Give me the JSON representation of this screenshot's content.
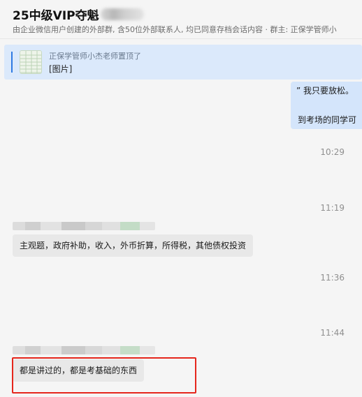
{
  "header": {
    "title": "25中级VIP夺魁",
    "subtitle": "由企业微信用户创建的外部群, 含50位外部联系人, 均已同意存档会话内容 · 群主: 正保学管师小"
  },
  "pinned": {
    "meta": "正保学管师小杰老师置顶了",
    "content": "[图片]"
  },
  "messages": {
    "right_bubble": {
      "line1": "” 我只要放松。",
      "line2": "到考场的同学可"
    },
    "time1": "10:29",
    "time2": "11:19",
    "msg1": "主观题，政府补助，收入，外币折算，所得税，其他债权投资",
    "time3": "11:36",
    "time4": "11:44",
    "msg2": "都是讲过的，都是考基础的东西"
  },
  "colors": {
    "accent": "#2f7be3",
    "highlight": "#e5261c"
  }
}
